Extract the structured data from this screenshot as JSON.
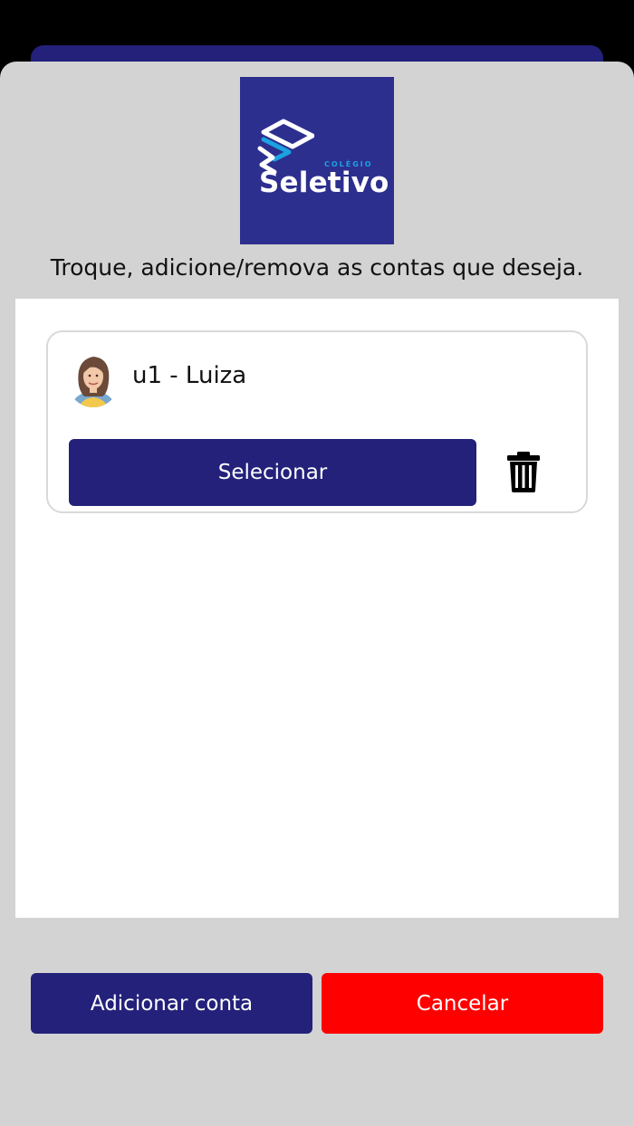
{
  "brand": {
    "colegio": "COLÉGIO",
    "name": "Seletivo"
  },
  "subtitle": "Troque, adicione/remova as contas que deseja.",
  "accounts": [
    {
      "name": "u1 - Luiza",
      "select_label": "Selecionar",
      "delete_icon": "trash-icon"
    }
  ],
  "actions": {
    "add_label": "Adicionar conta",
    "cancel_label": "Cancelar"
  },
  "colors": {
    "primary": "#23217a",
    "danger": "#ff0000",
    "sheet": "#d3d3d3"
  }
}
